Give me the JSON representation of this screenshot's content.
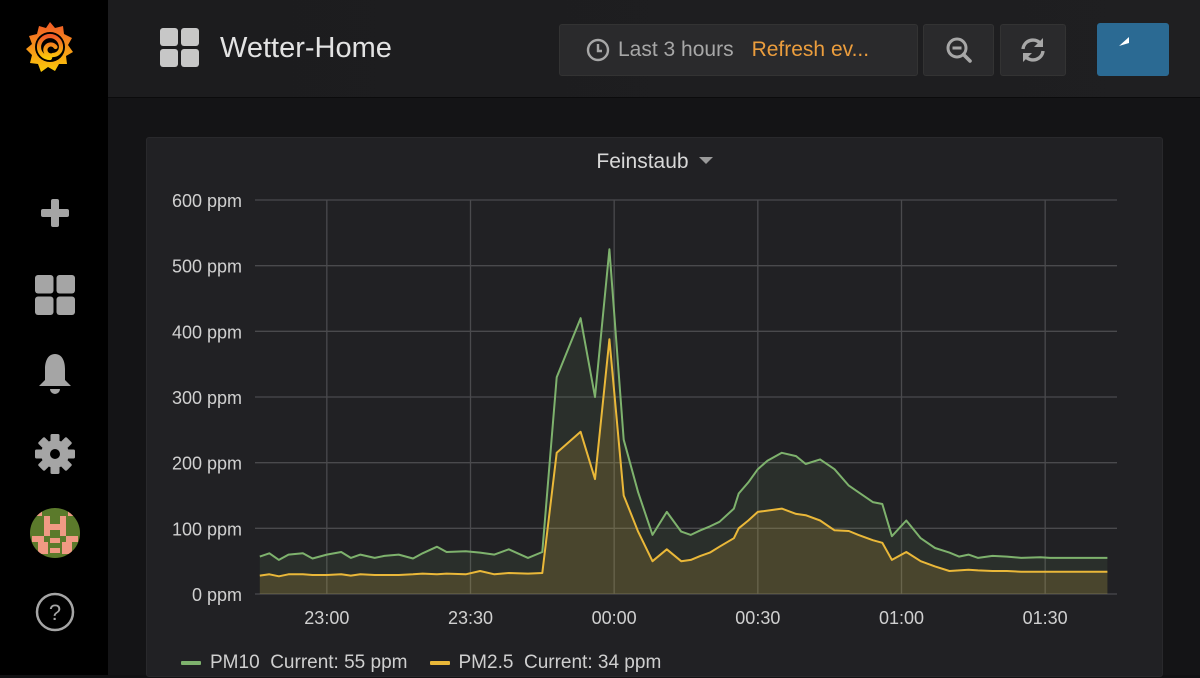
{
  "navbar": {
    "dashboard_title": "Wetter-Home",
    "time_range": "Last 3 hours",
    "refresh_label": "Refresh ev...",
    "zoom_out_icon": "zoom-out-icon",
    "refresh_icon": "refresh-icon",
    "back_icon": "reply-arrow-icon"
  },
  "sidebar": {
    "items": [
      {
        "name": "create",
        "icon": "plus-icon"
      },
      {
        "name": "dashboards",
        "icon": "grid-icon"
      },
      {
        "name": "alerting",
        "icon": "bell-icon"
      },
      {
        "name": "configuration",
        "icon": "gear-icon"
      },
      {
        "name": "profile",
        "icon": "avatar"
      },
      {
        "name": "help",
        "icon": "question-icon"
      }
    ]
  },
  "colors": {
    "pm10": "#7eb26d",
    "pm25": "#eab839",
    "accent": "#eb9d3d",
    "back_button": "#2b6a93"
  },
  "panel": {
    "title": "Feinstaub",
    "legend": [
      {
        "label": "PM10",
        "current_text": "Current: 55 ppm"
      },
      {
        "label": "PM2.5",
        "current_text": "Current: 34 ppm"
      }
    ]
  },
  "chart_data": {
    "type": "area",
    "title": "Feinstaub",
    "xlabel": "",
    "ylabel": "",
    "ylim": [
      0,
      600
    ],
    "yticks": [
      0,
      100,
      200,
      300,
      400,
      500,
      600
    ],
    "ytick_labels": [
      "0 ppm",
      "100 ppm",
      "200 ppm",
      "300 ppm",
      "400 ppm",
      "500 ppm",
      "600 ppm"
    ],
    "xlim_minutes": [
      -15,
      165
    ],
    "xticks_minutes": [
      0,
      30,
      60,
      90,
      120,
      150
    ],
    "xtick_labels": [
      "23:00",
      "23:30",
      "00:00",
      "00:30",
      "01:00",
      "01:30"
    ],
    "grid": true,
    "legend_position": "bottom",
    "x_minutes_from_2300": [
      -14,
      -12,
      -10,
      -8,
      -5,
      -3,
      0,
      3,
      5,
      7,
      10,
      12,
      15,
      18,
      20,
      23,
      25,
      29,
      32,
      35,
      38,
      42,
      45,
      48,
      53,
      56,
      59,
      62,
      65,
      68,
      71,
      74,
      76,
      78,
      80,
      82,
      85,
      86,
      88,
      90,
      92,
      95,
      98,
      100,
      103,
      106,
      109,
      111,
      114,
      116,
      118,
      121,
      124,
      127,
      130,
      132,
      134,
      136,
      139,
      142,
      145,
      149,
      151,
      153,
      156,
      159,
      163
    ],
    "series": [
      {
        "name": "PM10",
        "values": [
          57,
          62,
          52,
          60,
          62,
          54,
          60,
          64,
          55,
          60,
          55,
          58,
          60,
          54,
          62,
          72,
          64,
          65,
          63,
          60,
          68,
          55,
          64,
          330,
          420,
          300,
          525,
          235,
          155,
          90,
          125,
          95,
          90,
          97,
          103,
          110,
          130,
          153,
          170,
          190,
          203,
          215,
          210,
          198,
          205,
          190,
          165,
          155,
          140,
          137,
          88,
          112,
          85,
          70,
          63,
          57,
          60,
          55,
          58,
          57,
          55,
          56,
          55,
          55,
          55,
          55,
          55
        ]
      },
      {
        "name": "PM2.5",
        "values": [
          28,
          30,
          27,
          30,
          30,
          29,
          29,
          30,
          28,
          30,
          29,
          29,
          29,
          30,
          31,
          30,
          31,
          30,
          35,
          30,
          32,
          31,
          32,
          215,
          247,
          175,
          388,
          150,
          95,
          50,
          68,
          50,
          52,
          58,
          63,
          72,
          85,
          100,
          112,
          125,
          127,
          130,
          122,
          120,
          112,
          97,
          96,
          90,
          82,
          78,
          52,
          64,
          50,
          42,
          35,
          36,
          37,
          36,
          35,
          35,
          34,
          34,
          34,
          34,
          34,
          34,
          34
        ]
      }
    ]
  }
}
